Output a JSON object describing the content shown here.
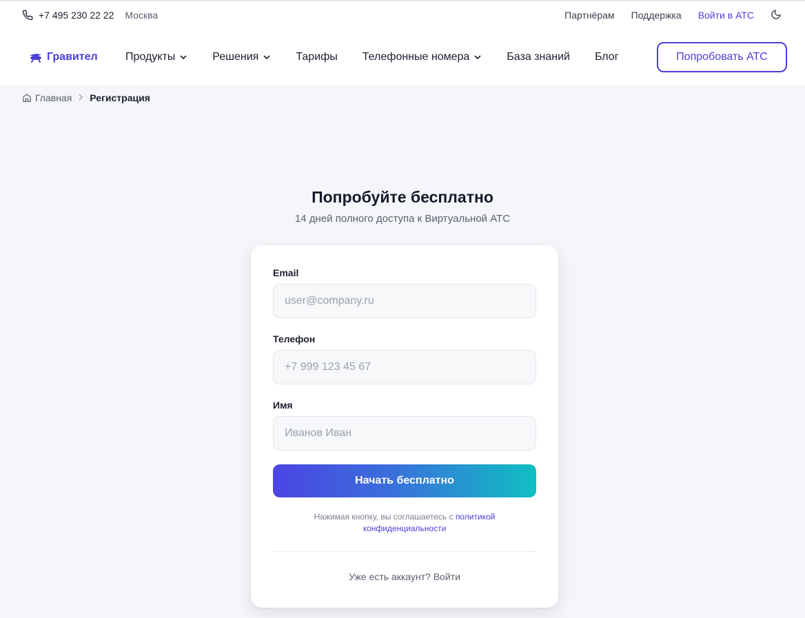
{
  "topbar": {
    "phone": "+7 495 230 22 22",
    "city": "Москва",
    "links": [
      "Партнёрам",
      "Поддержка"
    ],
    "login": "Войти в АТС"
  },
  "navbar": {
    "logo": "Гравител",
    "items": [
      {
        "label": "Продукты",
        "dropdown": true
      },
      {
        "label": "Решения",
        "dropdown": true
      },
      {
        "label": "Тарифы",
        "dropdown": false
      },
      {
        "label": "Телефонные номера",
        "dropdown": true
      },
      {
        "label": "База знаний",
        "dropdown": false
      },
      {
        "label": "Блог",
        "dropdown": false
      }
    ],
    "cta": "Попробовать АТС"
  },
  "breadcrumb": {
    "home": "Главная",
    "current": "Регистрация"
  },
  "hero": {
    "title": "Попробуйте бесплатно",
    "subtitle": "14 дней полного доступа к Виртуальной АТС"
  },
  "form": {
    "email_label": "Email",
    "email_placeholder": "user@company.ru",
    "phone_label": "Телефон",
    "phone_placeholder": "+7 999 123 45 67",
    "name_label": "Имя",
    "name_placeholder": "Иванов Иван",
    "submit": "Начать бесплатно",
    "policy_text": "Нажимая кнопку, вы соглашаетесь с ",
    "policy_link": "политикой конфиденциальности",
    "login_text": "Уже есть аккаунт? Войти"
  },
  "colors": {
    "accent": "#4a3fd6",
    "gradient_start": "#4b45e2",
    "gradient_end": "#10bfc2",
    "background": "#f5f6f9"
  }
}
